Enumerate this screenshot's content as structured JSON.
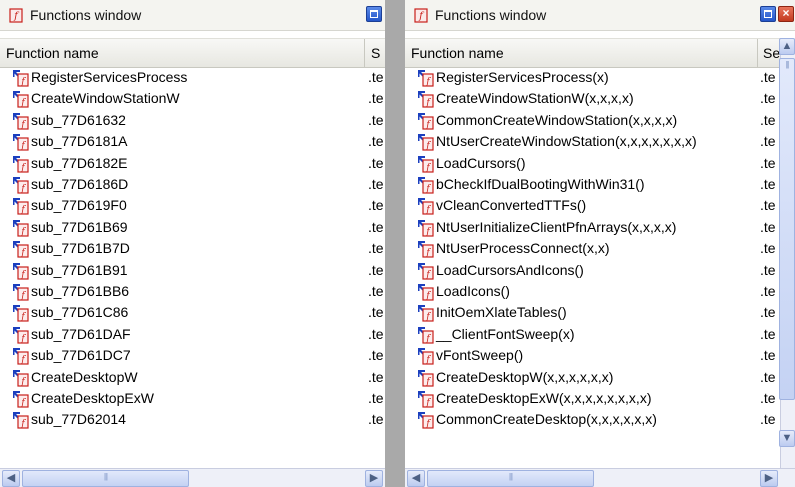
{
  "left": {
    "title": "Functions window",
    "col_name": "Function name",
    "col_segment": "S",
    "rows": [
      {
        "name": "RegisterServicesProcess",
        "segment": ".te"
      },
      {
        "name": "CreateWindowStationW",
        "segment": ".te"
      },
      {
        "name": "sub_77D61632",
        "segment": ".te"
      },
      {
        "name": "sub_77D6181A",
        "segment": ".te"
      },
      {
        "name": "sub_77D6182E",
        "segment": ".te"
      },
      {
        "name": "sub_77D6186D",
        "segment": ".te"
      },
      {
        "name": "sub_77D619F0",
        "segment": ".te"
      },
      {
        "name": "sub_77D61B69",
        "segment": ".te"
      },
      {
        "name": "sub_77D61B7D",
        "segment": ".te"
      },
      {
        "name": "sub_77D61B91",
        "segment": ".te"
      },
      {
        "name": "sub_77D61BB6",
        "segment": ".te"
      },
      {
        "name": "sub_77D61C86",
        "segment": ".te"
      },
      {
        "name": "sub_77D61DAF",
        "segment": ".te"
      },
      {
        "name": "sub_77D61DC7",
        "segment": ".te"
      },
      {
        "name": "CreateDesktopW",
        "segment": ".te"
      },
      {
        "name": "CreateDesktopExW",
        "segment": ".te"
      },
      {
        "name": "sub_77D62014",
        "segment": ".te"
      }
    ]
  },
  "right": {
    "title": "Functions window",
    "col_name": "Function name",
    "col_segment": "Se",
    "rows": [
      {
        "name": "RegisterServicesProcess(x)",
        "segment": ".te"
      },
      {
        "name": "CreateWindowStationW(x,x,x,x)",
        "segment": ".te"
      },
      {
        "name": "CommonCreateWindowStation(x,x,x,x)",
        "segment": ".te"
      },
      {
        "name": "NtUserCreateWindowStation(x,x,x,x,x,x,x)",
        "segment": ".te"
      },
      {
        "name": "LoadCursors()",
        "segment": ".te"
      },
      {
        "name": "bCheckIfDualBootingWithWin31()",
        "segment": ".te"
      },
      {
        "name": "vCleanConvertedTTFs()",
        "segment": ".te"
      },
      {
        "name": "NtUserInitializeClientPfnArrays(x,x,x,x)",
        "segment": ".te"
      },
      {
        "name": "NtUserProcessConnect(x,x)",
        "segment": ".te"
      },
      {
        "name": "LoadCursorsAndIcons()",
        "segment": ".te"
      },
      {
        "name": "LoadIcons()",
        "segment": ".te"
      },
      {
        "name": "InitOemXlateTables()",
        "segment": ".te"
      },
      {
        "name": "__ClientFontSweep(x)",
        "segment": ".te"
      },
      {
        "name": "vFontSweep()",
        "segment": ".te"
      },
      {
        "name": "CreateDesktopW(x,x,x,x,x,x)",
        "segment": ".te"
      },
      {
        "name": "CreateDesktopExW(x,x,x,x,x,x,x,x)",
        "segment": ".te"
      },
      {
        "name": "CommonCreateDesktop(x,x,x,x,x,x)",
        "segment": ".te"
      }
    ]
  },
  "colors": {
    "divider": "#a9a9a9",
    "titlebar": "#f4f4f0",
    "icon_red": "#c8201a",
    "icon_blue": "#1b3fbf"
  },
  "icons": {
    "title": "function-window-icon",
    "row": "function-icon",
    "scroll_left": "arrow-left-icon",
    "scroll_right": "arrow-right-icon"
  }
}
